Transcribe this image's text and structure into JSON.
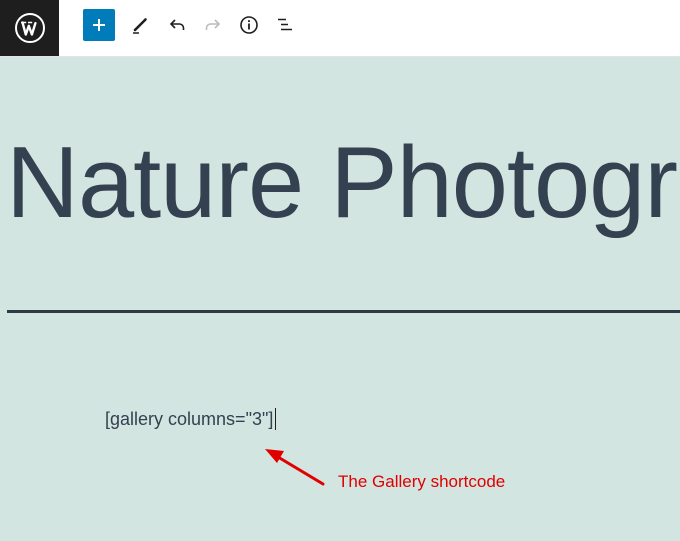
{
  "toolbar": {
    "logo_icon": "wordpress-logo-icon",
    "add_block_icon": "plus-icon",
    "tools_icon": "pencil-icon",
    "undo_icon": "undo-icon",
    "redo_icon": "redo-icon",
    "details_icon": "info-icon",
    "outline_icon": "list-view-icon",
    "accent_color": "#007cba"
  },
  "post": {
    "title": "Nature Photography",
    "shortcode": "[gallery columns=\"3\"]"
  },
  "annotation": {
    "label": "The Gallery shortcode",
    "color": "#e00000"
  },
  "colors": {
    "canvas_background": "#d3e5e0",
    "text": "#344150"
  }
}
